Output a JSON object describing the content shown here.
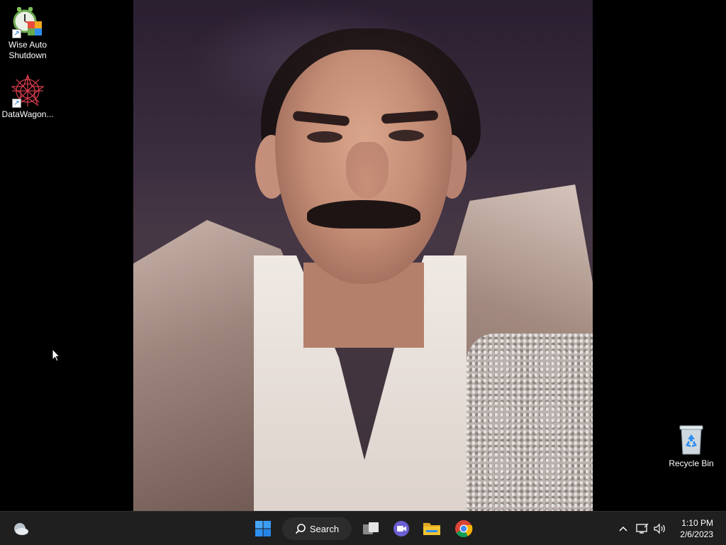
{
  "desktop": {
    "icons": [
      {
        "label": "Wise Auto Shutdown",
        "icon": "wise-auto-shutdown-icon"
      },
      {
        "label": "DataWagon...",
        "icon": "datawagon-icon"
      },
      {
        "label": "Recycle Bin",
        "icon": "recycle-bin-icon"
      }
    ]
  },
  "taskbar": {
    "widgets_icon": "weather-widget-icon",
    "start_icon": "windows-start-icon",
    "search_label": "Search",
    "apps": [
      {
        "name": "task-view",
        "icon": "task-view-icon"
      },
      {
        "name": "teams-chat",
        "icon": "meet-chat-icon"
      },
      {
        "name": "file-explorer",
        "icon": "folder-icon"
      },
      {
        "name": "chrome",
        "icon": "chrome-icon"
      }
    ],
    "tray": {
      "time": "1:10 PM",
      "date": "2/6/2023"
    }
  },
  "colors": {
    "taskbar_bg": "#1f1f1f",
    "start_blue": "#2f8ff0",
    "folder_yellow": "#f4c430"
  }
}
